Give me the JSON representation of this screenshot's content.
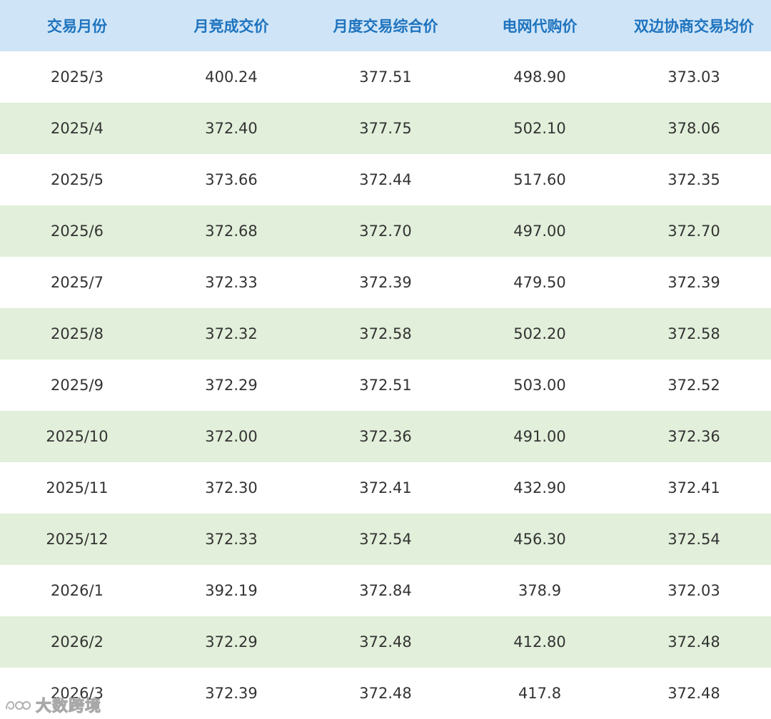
{
  "chart_data": {
    "type": "table",
    "columns": [
      "交易月份",
      "月竞成交价",
      "月度交易综合价",
      "电网代购价",
      "双边协商交易均价"
    ],
    "rows": [
      [
        "2025/3",
        "400.24",
        "377.51",
        "498.90",
        "373.03"
      ],
      [
        "2025/4",
        "372.40",
        "377.75",
        "502.10",
        "378.06"
      ],
      [
        "2025/5",
        "373.66",
        "372.44",
        "517.60",
        "372.35"
      ],
      [
        "2025/6",
        "372.68",
        "372.70",
        "497.00",
        "372.70"
      ],
      [
        "2025/7",
        "372.33",
        "372.39",
        "479.50",
        "372.39"
      ],
      [
        "2025/8",
        "372.32",
        "372.58",
        "502.20",
        "372.58"
      ],
      [
        "2025/9",
        "372.29",
        "372.51",
        "503.00",
        "372.52"
      ],
      [
        "2025/10",
        "372.00",
        "372.36",
        "491.00",
        "372.36"
      ],
      [
        "2025/11",
        "372.30",
        "372.41",
        "432.90",
        "372.41"
      ],
      [
        "2025/12",
        "372.33",
        "372.54",
        "456.30",
        "372.54"
      ],
      [
        "2026/1",
        "392.19",
        "372.84",
        "378.9",
        "372.03"
      ],
      [
        "2026/2",
        "372.29",
        "372.48",
        "412.80",
        "372.48"
      ],
      [
        "2026/3",
        "372.39",
        "372.48",
        "417.8",
        "372.48"
      ]
    ],
    "header_bg": "#cfe5f7",
    "header_text_color": "#1e73be",
    "stripe_color": "#e2efda",
    "row_bg": "#ffffff",
    "body_text_color": "#333333"
  },
  "watermark": {
    "text": "大数跨境"
  }
}
